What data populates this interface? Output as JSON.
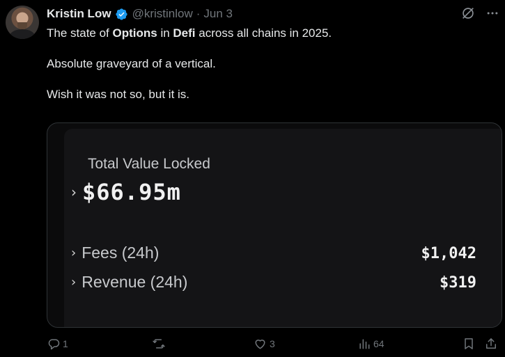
{
  "author": {
    "name": "Kristin Low",
    "handle": "@kristinlow",
    "separator": "·",
    "date": "Jun 3"
  },
  "icons": {
    "verified": "verified-badge-icon",
    "grok": "grok-icon",
    "more": "more-icon",
    "reply": "reply-icon",
    "retweet": "retweet-icon",
    "like": "like-icon",
    "views": "views-icon",
    "bookmark": "bookmark-icon",
    "share": "share-icon"
  },
  "tweet": {
    "line1_pre": "The state of ",
    "line1_bold1": "Options",
    "line1_mid": " in ",
    "line1_bold2": "Defi",
    "line1_post": " across all chains in 2025.",
    "line2": "Absolute graveyard of a vertical.",
    "line3": "Wish it was not so, but it is."
  },
  "card": {
    "tvl_label": "Total Value Locked",
    "tvl_value": "$66.95m",
    "chevron": "›",
    "fees_label": "Fees (24h)",
    "fees_value": "$1,042",
    "revenue_label": "Revenue (24h)",
    "revenue_value": "$319"
  },
  "stats": {
    "replies": "1",
    "retweets": "",
    "likes": "3",
    "views": "64"
  },
  "colors": {
    "background": "#000000",
    "text": "#e7e9ea",
    "muted": "#71767b",
    "verified": "#1d9bf0",
    "card_border": "#2f3336"
  }
}
